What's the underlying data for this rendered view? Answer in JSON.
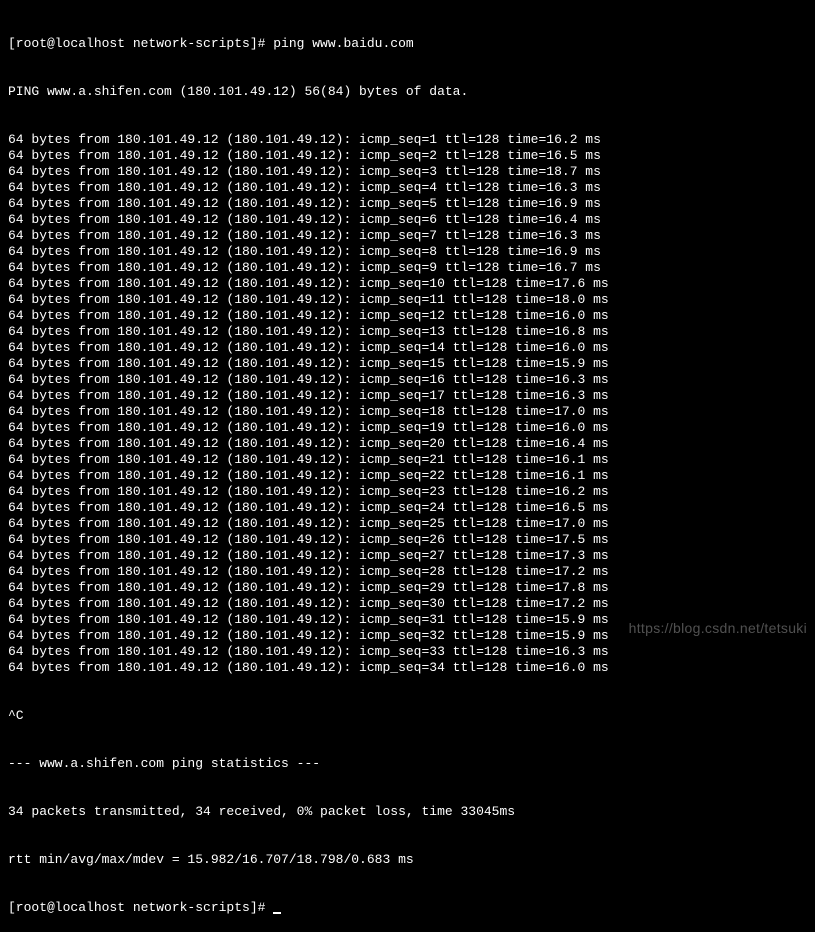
{
  "prompt_user": "root",
  "prompt_host": "localhost",
  "prompt_cwd": "network-scripts",
  "command": "ping www.baidu.com",
  "ping_header": "PING www.a.shifen.com (180.101.49.12) 56(84) bytes of data.",
  "ip": "180.101.49.12",
  "ttl": "128",
  "replies": [
    {
      "seq": 1,
      "time": "16.2"
    },
    {
      "seq": 2,
      "time": "16.5"
    },
    {
      "seq": 3,
      "time": "18.7"
    },
    {
      "seq": 4,
      "time": "16.3"
    },
    {
      "seq": 5,
      "time": "16.9"
    },
    {
      "seq": 6,
      "time": "16.4"
    },
    {
      "seq": 7,
      "time": "16.3"
    },
    {
      "seq": 8,
      "time": "16.9"
    },
    {
      "seq": 9,
      "time": "16.7"
    },
    {
      "seq": 10,
      "time": "17.6"
    },
    {
      "seq": 11,
      "time": "18.0"
    },
    {
      "seq": 12,
      "time": "16.0"
    },
    {
      "seq": 13,
      "time": "16.8"
    },
    {
      "seq": 14,
      "time": "16.0"
    },
    {
      "seq": 15,
      "time": "15.9"
    },
    {
      "seq": 16,
      "time": "16.3"
    },
    {
      "seq": 17,
      "time": "16.3"
    },
    {
      "seq": 18,
      "time": "17.0"
    },
    {
      "seq": 19,
      "time": "16.0"
    },
    {
      "seq": 20,
      "time": "16.4"
    },
    {
      "seq": 21,
      "time": "16.1"
    },
    {
      "seq": 22,
      "time": "16.1"
    },
    {
      "seq": 23,
      "time": "16.2"
    },
    {
      "seq": 24,
      "time": "16.5"
    },
    {
      "seq": 25,
      "time": "17.0"
    },
    {
      "seq": 26,
      "time": "17.5"
    },
    {
      "seq": 27,
      "time": "17.3"
    },
    {
      "seq": 28,
      "time": "17.2"
    },
    {
      "seq": 29,
      "time": "17.8"
    },
    {
      "seq": 30,
      "time": "17.2"
    },
    {
      "seq": 31,
      "time": "15.9"
    },
    {
      "seq": 32,
      "time": "15.9"
    },
    {
      "seq": 33,
      "time": "16.3"
    },
    {
      "seq": 34,
      "time": "16.0"
    }
  ],
  "interrupt": "^C",
  "stats_header": "--- www.a.shifen.com ping statistics ---",
  "stats_line1": "34 packets transmitted, 34 received, 0% packet loss, time 33045ms",
  "stats_line2": "rtt min/avg/max/mdev = 15.982/16.707/18.798/0.683 ms",
  "watermark": "https://blog.csdn.net/tetsuki"
}
